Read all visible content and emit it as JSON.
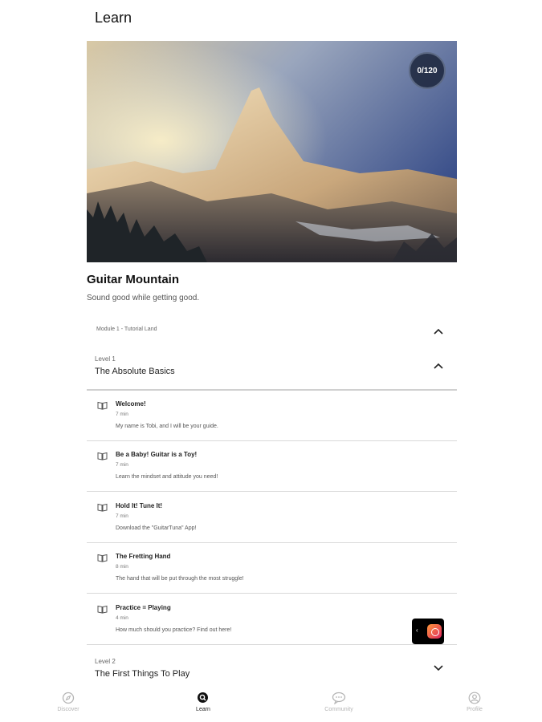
{
  "header": {
    "title": "Learn"
  },
  "hero": {
    "progress": "0/120"
  },
  "course": {
    "title": "Guitar Mountain",
    "subtitle": "Sound good while getting good."
  },
  "module": {
    "label": "Module 1 - Tutorial Land",
    "expanded": true
  },
  "levels": [
    {
      "small": "Level 1",
      "title": "The Absolute Basics",
      "expanded": true
    },
    {
      "small": "Level 2",
      "title": "The First Things To Play",
      "expanded": false
    }
  ],
  "lessons": [
    {
      "icon": "book-icon",
      "title": "Welcome!",
      "duration": "7 min",
      "description": "My name is Tobi, and I will be your guide."
    },
    {
      "icon": "book-icon",
      "title": "Be a Baby! Guitar is a Toy!",
      "duration": "7 min",
      "description": "Learn the mindset and attitude you need!"
    },
    {
      "icon": "book-icon",
      "title": "Hold It! Tune It!",
      "duration": "7 min",
      "description": "Download the \"GuitarTuna\" App!"
    },
    {
      "icon": "book-icon",
      "title": "The Fretting Hand",
      "duration": "8 min",
      "description": "The hand that will be put through the most struggle!"
    },
    {
      "icon": "book-icon",
      "title": "Practice = Playing",
      "duration": "4 min",
      "description": "How much should you practice? Find out here!"
    }
  ],
  "nav": [
    {
      "label": "Discover",
      "icon": "compass-icon",
      "active": false
    },
    {
      "label": "Learn",
      "icon": "search-icon",
      "active": true
    },
    {
      "label": "Community",
      "icon": "chat-icon",
      "active": false
    },
    {
      "label": "Profile",
      "icon": "user-icon",
      "active": false
    }
  ]
}
